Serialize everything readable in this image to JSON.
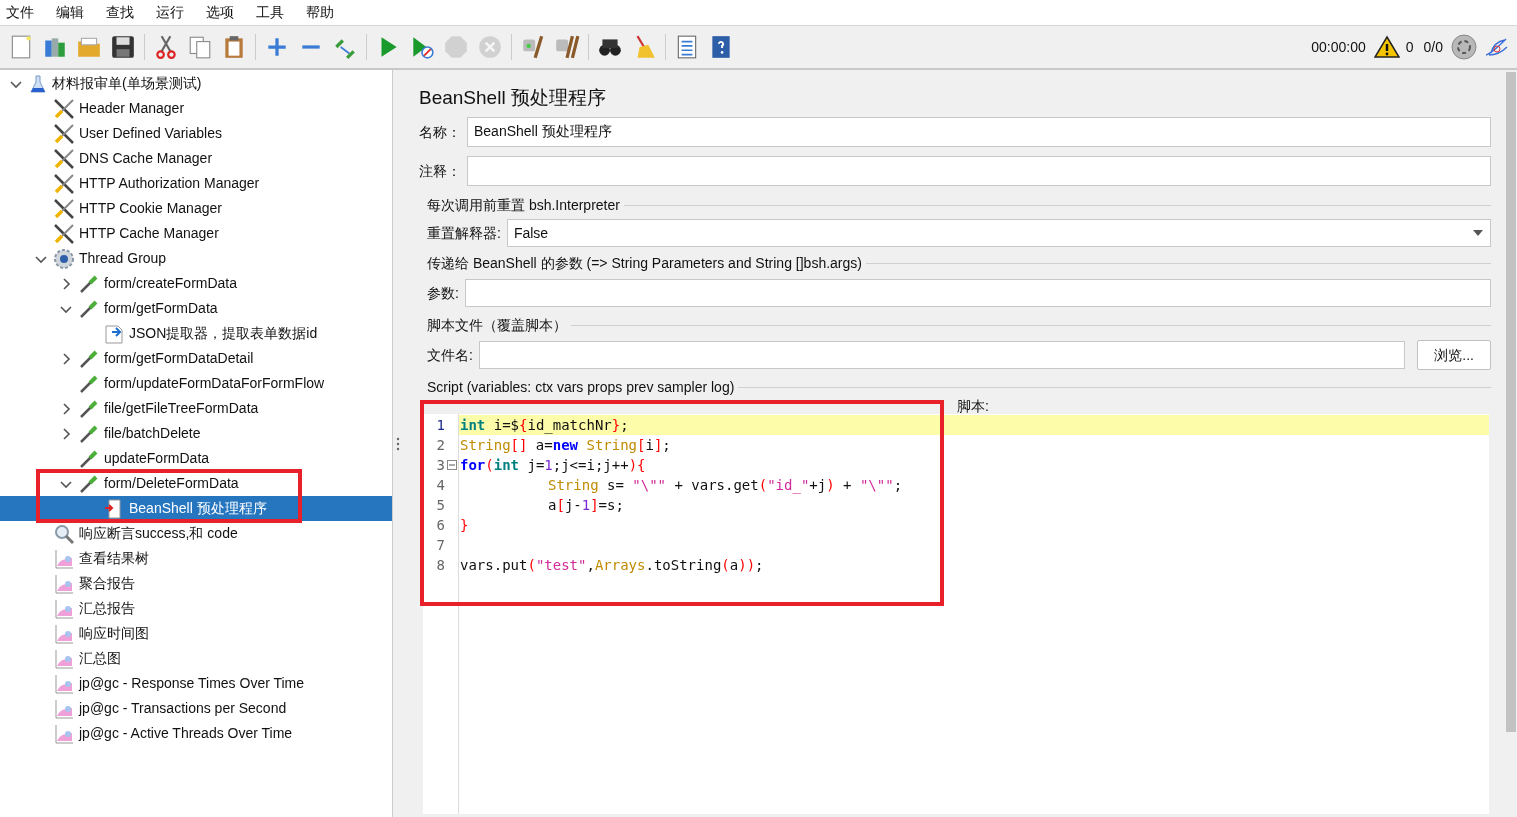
{
  "menu": [
    "文件",
    "编辑",
    "查找",
    "运行",
    "选项",
    "工具",
    "帮助"
  ],
  "toolbar": [
    [
      {
        "kind": "new",
        "disabled": false
      },
      {
        "kind": "templates",
        "disabled": false
      },
      {
        "kind": "open",
        "disabled": false
      },
      {
        "kind": "save",
        "disabled": false
      }
    ],
    [
      {
        "kind": "cut",
        "disabled": false
      },
      {
        "kind": "copy",
        "disabled": false
      },
      {
        "kind": "paste",
        "disabled": false
      }
    ],
    [
      {
        "kind": "expand",
        "disabled": false
      },
      {
        "kind": "collapse",
        "disabled": false
      },
      {
        "kind": "toggle",
        "disabled": false
      }
    ],
    [
      {
        "kind": "start",
        "disabled": false
      },
      {
        "kind": "start-no-pause",
        "disabled": false
      },
      {
        "kind": "stop",
        "disabled": true
      },
      {
        "kind": "shutdown",
        "disabled": true
      }
    ],
    [
      {
        "kind": "clear",
        "disabled": false
      },
      {
        "kind": "clear-all",
        "disabled": false
      }
    ],
    [
      {
        "kind": "search",
        "disabled": false
      },
      {
        "kind": "reset-search",
        "disabled": false
      }
    ],
    [
      {
        "kind": "functions",
        "disabled": false
      },
      {
        "kind": "help",
        "disabled": false
      }
    ]
  ],
  "status": {
    "elapsed": "00:00:00",
    "warnings": "0",
    "threads": "0/0"
  },
  "tree": {
    "label": "材料报审单(单场景测试)",
    "kind": "plan",
    "expanded": true,
    "selected": false,
    "children": [
      {
        "label": "Header Manager",
        "kind": "config",
        "selected": false
      },
      {
        "label": "User Defined Variables",
        "kind": "config",
        "selected": false
      },
      {
        "label": "DNS Cache Manager",
        "kind": "config",
        "selected": false
      },
      {
        "label": "HTTP Authorization Manager",
        "kind": "config",
        "selected": false
      },
      {
        "label": "HTTP Cookie Manager",
        "kind": "config",
        "selected": false
      },
      {
        "label": "HTTP Cache Manager",
        "kind": "config",
        "selected": false
      },
      {
        "label": "Thread Group",
        "kind": "threads",
        "expanded": true,
        "selected": false,
        "children": [
          {
            "label": "form/createFormData",
            "kind": "sampler",
            "expanded": false,
            "selected": false
          },
          {
            "label": "form/getFormData",
            "kind": "sampler",
            "expanded": true,
            "selected": false,
            "children": [
              {
                "label": "JSON提取器，提取表单数据id",
                "kind": "postprocessor",
                "selected": false
              }
            ]
          },
          {
            "label": "form/getFormDataDetail",
            "kind": "sampler",
            "expanded": false,
            "selected": false
          },
          {
            "label": "form/updateFormDataForFormFlow",
            "kind": "sampler",
            "selected": false
          },
          {
            "label": "file/getFileTreeFormData",
            "kind": "sampler",
            "expanded": false,
            "selected": false
          },
          {
            "label": "file/batchDelete",
            "kind": "sampler",
            "expanded": false,
            "selected": false
          },
          {
            "label": "updateFormData",
            "kind": "sampler",
            "selected": false
          },
          {
            "label": "form/DeleteFormData",
            "kind": "sampler",
            "expanded": true,
            "selected": false,
            "annotated": true,
            "children": [
              {
                "label": "BeanShell 预处理程序",
                "kind": "preprocessor",
                "selected": true
              }
            ]
          }
        ]
      },
      {
        "label": "响应断言success,和 code",
        "kind": "assertion",
        "selected": false
      },
      {
        "label": "查看结果树",
        "kind": "listener",
        "selected": false
      },
      {
        "label": "聚合报告",
        "kind": "listener",
        "selected": false
      },
      {
        "label": "汇总报告",
        "kind": "listener",
        "selected": false
      },
      {
        "label": "响应时间图",
        "kind": "listener",
        "selected": false
      },
      {
        "label": "汇总图",
        "kind": "listener",
        "selected": false
      },
      {
        "label": "jp@gc - Response Times Over Time",
        "kind": "listener",
        "selected": false
      },
      {
        "label": "jp@gc - Transactions per Second",
        "kind": "listener",
        "selected": false
      },
      {
        "label": "jp@gc - Active Threads Over Time",
        "kind": "listener",
        "selected": false
      }
    ]
  },
  "panel": {
    "title": "BeanShell 预处理程序",
    "name": {
      "label": "名称：",
      "value": "BeanShell 预处理程序"
    },
    "comment": {
      "label": "注释："
    },
    "reset_section": {
      "title": "每次调用前重置 bsh.Interpreter",
      "label": "重置解释器:",
      "value": "False"
    },
    "params_section": {
      "title": "传递给 BeanShell 的参数 (=> String Parameters and String []bsh.args)",
      "label": "参数:"
    },
    "file_section": {
      "title": "脚本文件（覆盖脚本）",
      "label": "文件名:",
      "button": "浏览..."
    },
    "script_section": {
      "title": "Script (variables: ctx vars props prev sampler log)",
      "label": "脚本:",
      "annotated": true,
      "lines": [
        {
          "number": "1",
          "current": true,
          "tokens": [
            {
              "kind": "kw",
              "text": "int"
            },
            {
              "kind": "plain",
              "text": " i=$"
            },
            {
              "kind": "br",
              "text": "{"
            },
            {
              "kind": "plain",
              "text": "id_matchNr"
            },
            {
              "kind": "br",
              "text": "}"
            },
            {
              "kind": "plain",
              "text": ";"
            }
          ]
        },
        {
          "number": "2",
          "current": false,
          "tokens": [
            {
              "kind": "type",
              "text": "String"
            },
            {
              "kind": "br",
              "text": "[]"
            },
            {
              "kind": "plain",
              "text": " a="
            },
            {
              "kind": "kw2",
              "text": "new"
            },
            {
              "kind": "type",
              "text": " String"
            },
            {
              "kind": "br",
              "text": "["
            },
            {
              "kind": "plain",
              "text": "i"
            },
            {
              "kind": "br",
              "text": "]"
            },
            {
              "kind": "plain",
              "text": ";"
            }
          ]
        },
        {
          "number": "3",
          "current": false,
          "foldable": true,
          "tokens": [
            {
              "kind": "kw2",
              "text": "for"
            },
            {
              "kind": "br",
              "text": "("
            },
            {
              "kind": "kw",
              "text": "int"
            },
            {
              "kind": "plain",
              "text": " j="
            },
            {
              "kind": "num",
              "text": "1"
            },
            {
              "kind": "plain",
              "text": ";j<=i;j++"
            },
            {
              "kind": "br",
              "text": "){"
            }
          ]
        },
        {
          "number": "4",
          "current": false,
          "indent": true,
          "tokens": [
            {
              "kind": "type",
              "text": "String"
            },
            {
              "kind": "plain",
              "text": " s= "
            },
            {
              "kind": "str",
              "text": "\"\\\"\""
            },
            {
              "kind": "plain",
              "text": " + vars.get"
            },
            {
              "kind": "br",
              "text": "("
            },
            {
              "kind": "str",
              "text": "\"id_\""
            },
            {
              "kind": "plain",
              "text": "+j"
            },
            {
              "kind": "br",
              "text": ")"
            },
            {
              "kind": "plain",
              "text": " + "
            },
            {
              "kind": "str",
              "text": "\"\\\"\""
            },
            {
              "kind": "plain",
              "text": ";"
            }
          ]
        },
        {
          "number": "5",
          "current": false,
          "indent": true,
          "tokens": [
            {
              "kind": "plain",
              "text": "a"
            },
            {
              "kind": "br",
              "text": "["
            },
            {
              "kind": "plain",
              "text": "j-"
            },
            {
              "kind": "num",
              "text": "1"
            },
            {
              "kind": "br",
              "text": "]"
            },
            {
              "kind": "plain",
              "text": "=s;"
            }
          ]
        },
        {
          "number": "6",
          "current": false,
          "tokens": [
            {
              "kind": "br",
              "text": "}"
            }
          ]
        },
        {
          "number": "7",
          "current": false
        },
        {
          "number": "8",
          "current": false,
          "tokens": [
            {
              "kind": "plain",
              "text": "vars.put"
            },
            {
              "kind": "br",
              "text": "("
            },
            {
              "kind": "str",
              "text": "\"test\""
            },
            {
              "kind": "plain",
              "text": ","
            },
            {
              "kind": "type",
              "text": "Arrays"
            },
            {
              "kind": "plain",
              "text": ".toString"
            },
            {
              "kind": "br",
              "text": "("
            },
            {
              "kind": "plain",
              "text": "a"
            },
            {
              "kind": "br",
              "text": "))"
            },
            {
              "kind": "plain",
              "text": ";"
            }
          ]
        }
      ]
    }
  }
}
